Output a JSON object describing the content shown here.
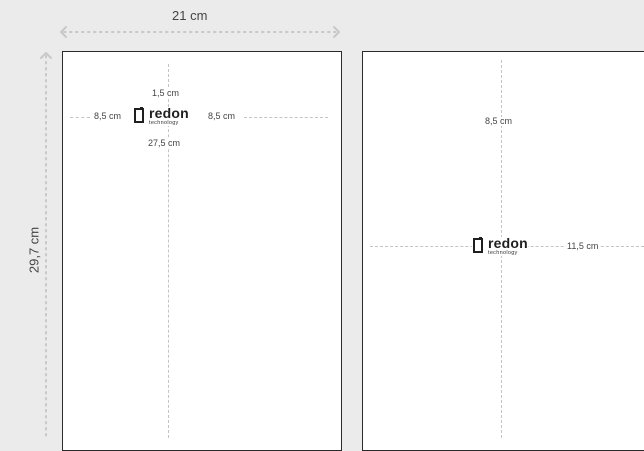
{
  "colors": {
    "background": "#ebebeb",
    "page": "#ffffff",
    "border": "#2b2b2b",
    "guide": "#c4c4c4",
    "dimension_arrow": "#c8c8c8"
  },
  "width_dimension": "21 cm",
  "height_dimension": "29,7 cm",
  "left_page": {
    "top_margin": "1,5 cm",
    "left_margin": "8,5 cm",
    "right_margin": "8,5 cm",
    "bottom_margin": "27,5 cm",
    "logo": {
      "name": "redon",
      "sub": "technology",
      "icon": "redon-mark-icon"
    }
  },
  "right_page": {
    "top_margin": "8,5 cm",
    "right_margin": "11,5 cm",
    "logo": {
      "name": "redon",
      "sub": "technology",
      "icon": "redon-mark-icon"
    }
  }
}
